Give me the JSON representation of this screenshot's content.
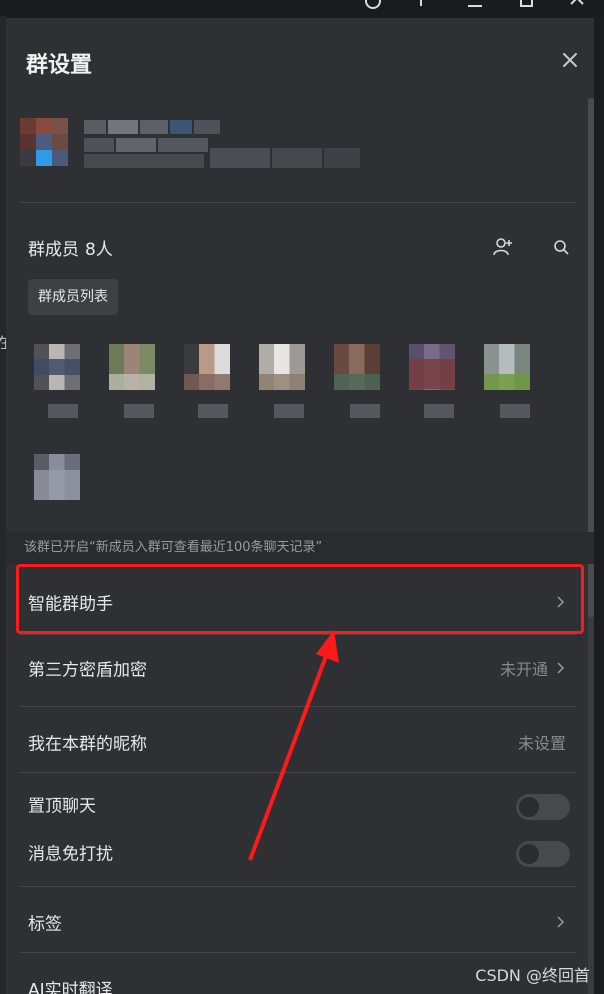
{
  "panel": {
    "title": "群设置",
    "group_name_hidden": true
  },
  "members": {
    "label": "群成员",
    "count": "8人",
    "tooltip": "群成员列表",
    "add_icon": "add-member-icon",
    "search_icon": "search-icon"
  },
  "notice": {
    "text": "该群已开启“新成员入群可查看最近100条聊天记录”"
  },
  "settings": {
    "assistant": {
      "label": "智能群助手"
    },
    "encryption": {
      "label": "第三方密盾加密",
      "value": "未开通"
    },
    "nickname": {
      "label": "我在本群的昵称",
      "value": "未设置"
    },
    "pin_chat": {
      "label": "置顶聊天",
      "on": false
    },
    "mute": {
      "label": "消息免打扰",
      "on": false
    },
    "tags": {
      "label": "标签"
    },
    "translate": {
      "label": "AI实时翻译"
    }
  },
  "background": {
    "left_peek_text": "在"
  },
  "watermark": {
    "text": "CSDN @终回首"
  },
  "colors": {
    "panel_bg": "#2f3033",
    "highlight": "#ff1a1a",
    "text": "#e8e8e8",
    "muted": "#8a8a8a"
  }
}
